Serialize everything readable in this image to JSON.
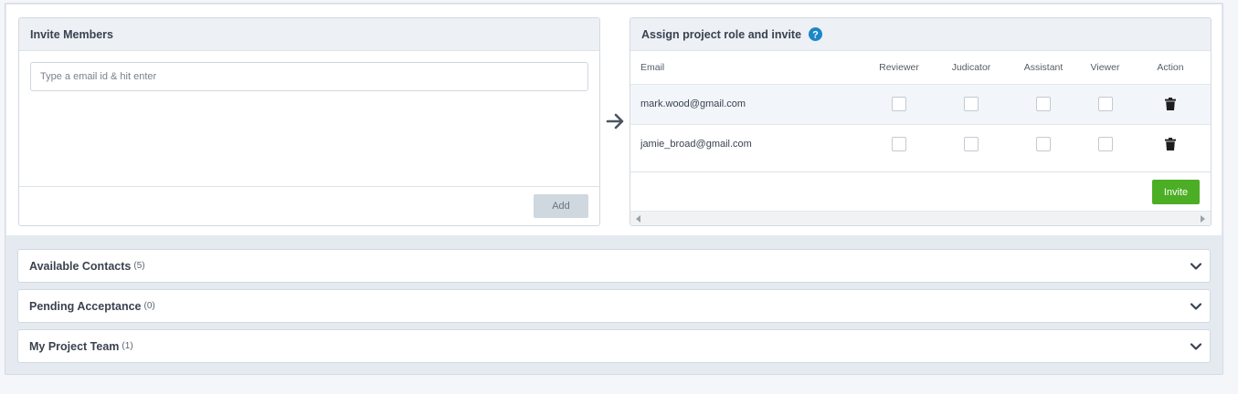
{
  "invite": {
    "title": "Invite Members",
    "email_placeholder": "Type a email id & hit enter",
    "add_label": "Add"
  },
  "assign": {
    "title": "Assign project role and invite",
    "columns": [
      "Email",
      "Reviewer",
      "Judicator",
      "Assistant",
      "Viewer",
      "Action"
    ],
    "rows": [
      {
        "email": "mark.wood@gmail.com",
        "reviewer": false,
        "judicator": false,
        "assistant": false,
        "viewer": false
      },
      {
        "email": "jamie_broad@gmail.com",
        "reviewer": false,
        "judicator": false,
        "assistant": false,
        "viewer": false
      }
    ],
    "invite_label": "Invite"
  },
  "sections": [
    {
      "title": "Available Contacts",
      "count": "(5)"
    },
    {
      "title": "Pending Acceptance",
      "count": "(0)"
    },
    {
      "title": "My Project Team",
      "count": "(1)"
    }
  ],
  "colors": {
    "accent_green": "#4cae25",
    "help_blue": "#1d86c8",
    "header_bg": "#edf1f5"
  },
  "icons": {
    "arrow": "arrow-right-icon",
    "help": "question-circle-icon",
    "delete": "trash-icon",
    "expand": "chevron-down-icon"
  }
}
